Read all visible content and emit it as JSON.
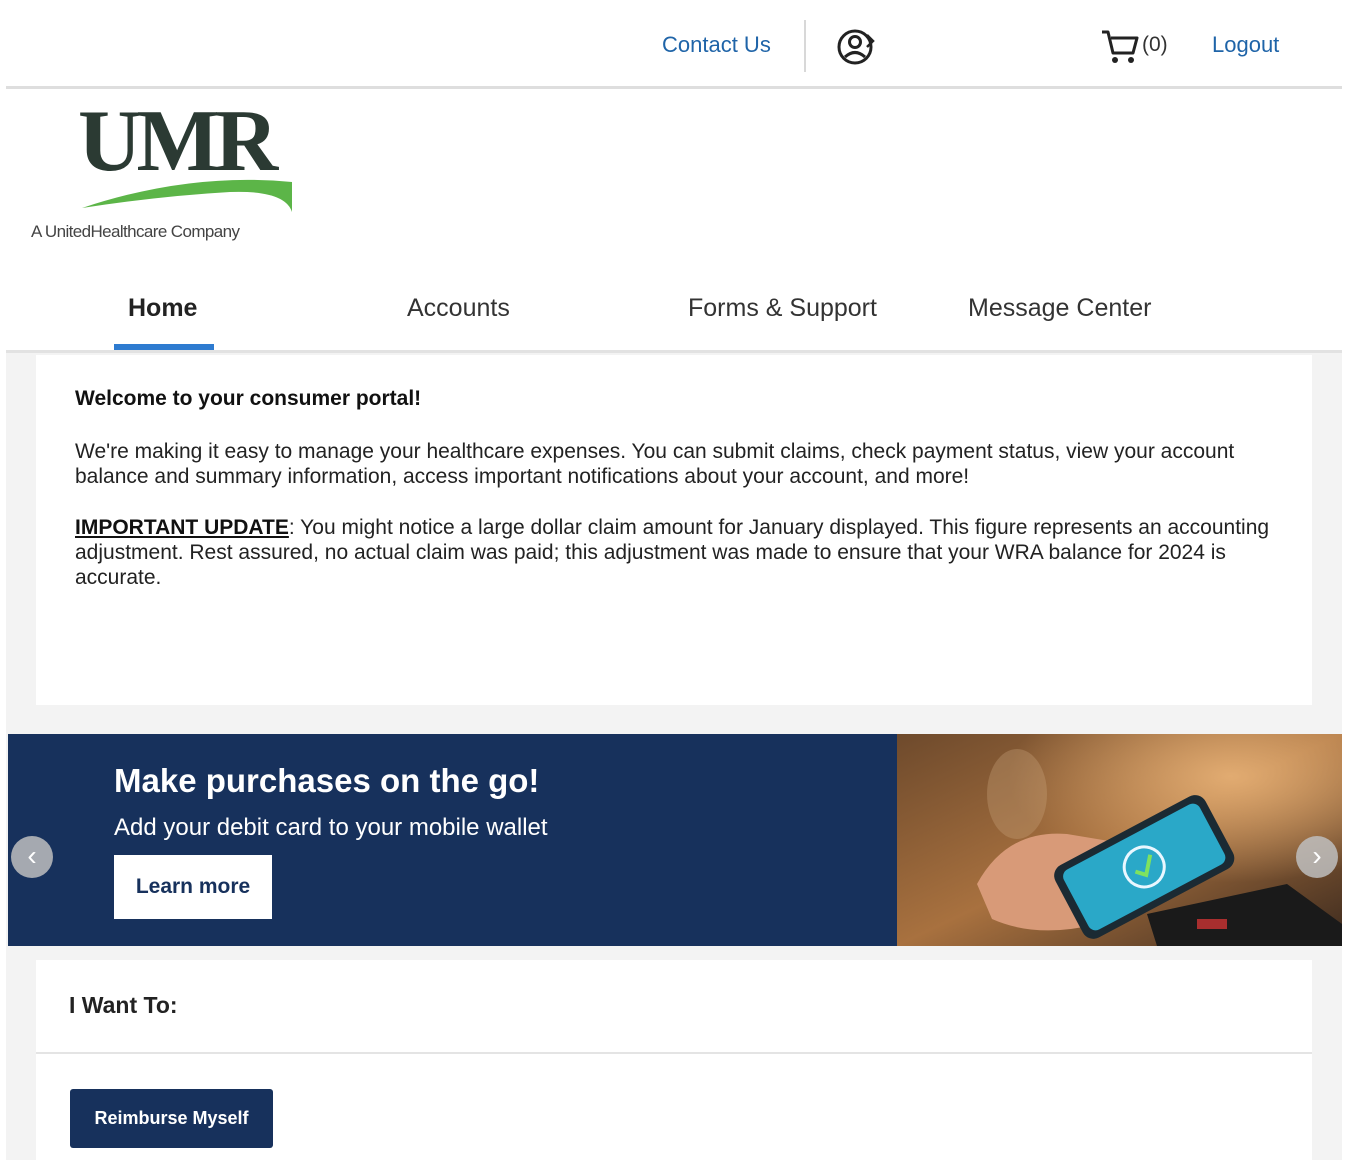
{
  "header": {
    "contact_label": "Contact Us",
    "user_icon": "user-circle-icon",
    "cart_icon": "cart-icon",
    "cart_count": "(0)",
    "logout_label": "Logout"
  },
  "logo": {
    "wordmark": "UMR",
    "tagline": "A UnitedHealthcare Company"
  },
  "nav": {
    "tabs": [
      {
        "label": "Home",
        "active": true
      },
      {
        "label": "Accounts",
        "active": false
      },
      {
        "label": "Forms & Support",
        "active": false
      },
      {
        "label": "Message Center",
        "active": false
      }
    ]
  },
  "welcome": {
    "title": "Welcome to your consumer portal!",
    "body": "We're making it easy to manage your healthcare expenses. You can submit claims, check payment status, view your account balance and summary information, access important notifications about your account, and more!",
    "update_label": "IMPORTANT UPDATE",
    "update_text": ": You might notice a large dollar claim amount for January displayed. This figure represents an accounting adjustment. Rest assured, no actual claim was paid; this adjustment was made to ensure that your WRA balance for 2024 is accurate."
  },
  "banner": {
    "title": "Make purchases on the go!",
    "subtitle": "Add your debit card to your mobile wallet",
    "button_label": "Learn more",
    "prev_icon": "chevron-left-icon",
    "next_icon": "chevron-right-icon",
    "prev_glyph": "‹",
    "next_glyph": "›"
  },
  "want": {
    "title": "I Want To:",
    "button_label": "Reimburse Myself"
  },
  "colors": {
    "link": "#1f64a8",
    "navy": "#17315c",
    "accent_tab": "#2e7bd0",
    "logo_green": "#5cb548",
    "logo_dark": "#2b3a33"
  }
}
